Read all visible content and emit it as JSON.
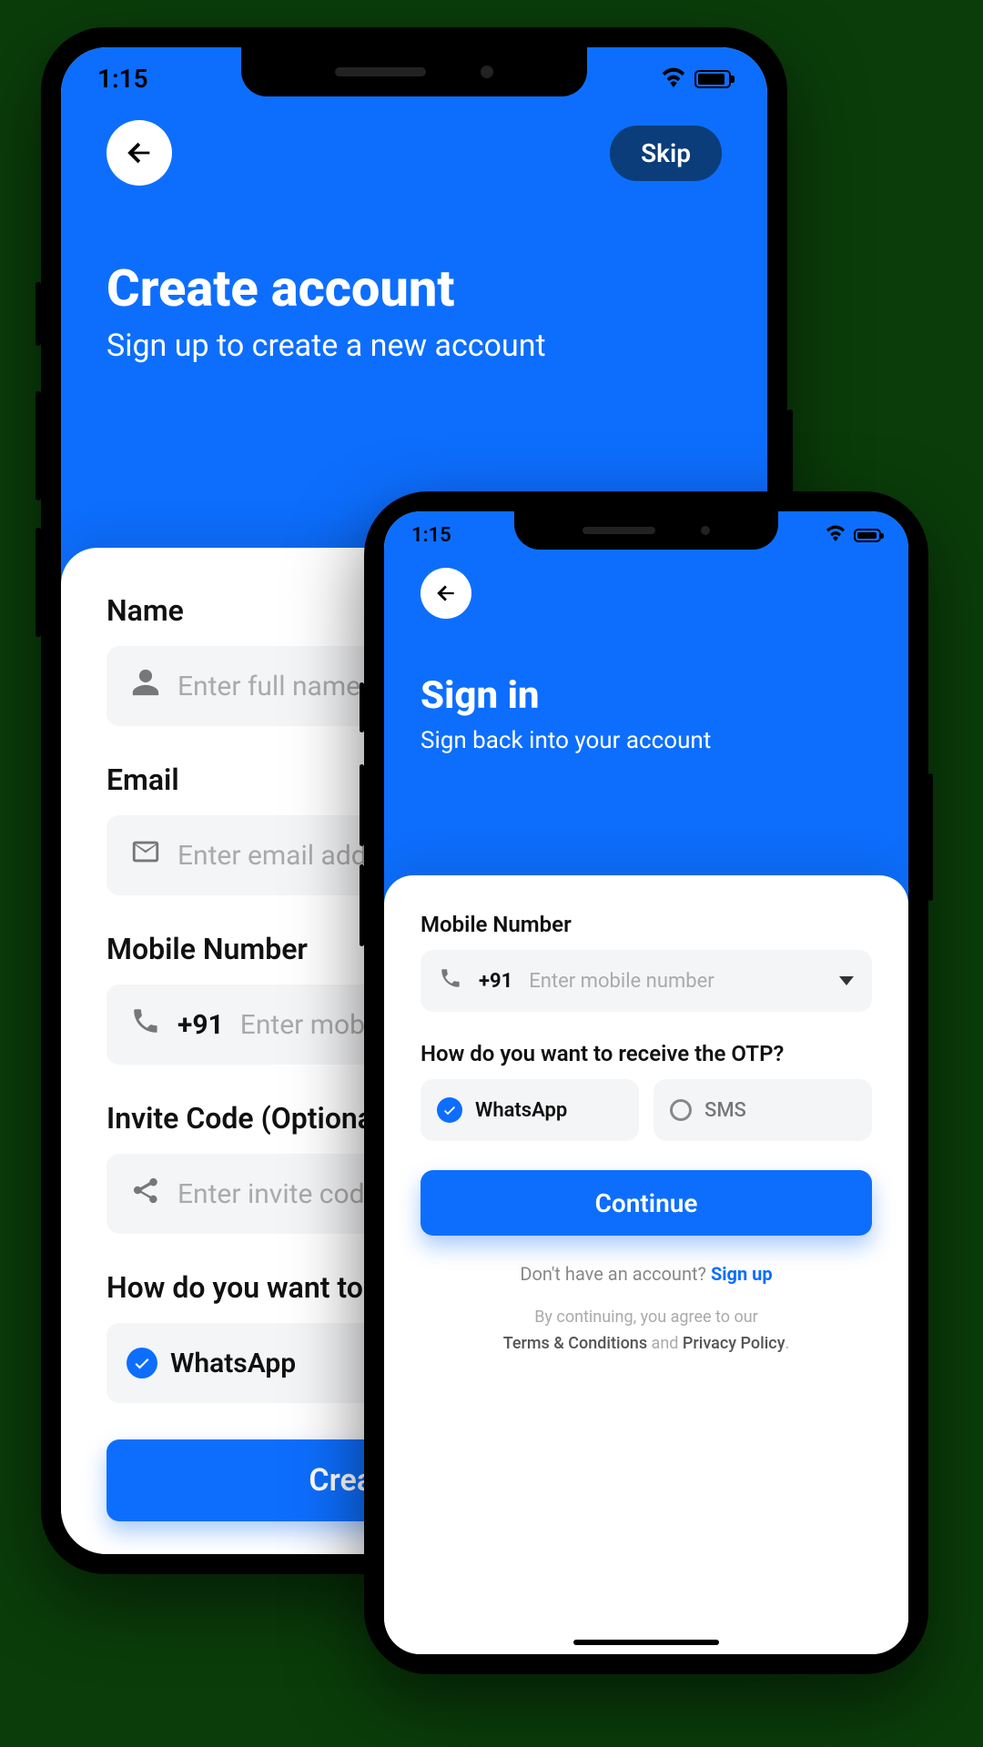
{
  "status_time": "1:15",
  "large": {
    "title": "Create account",
    "subtitle": "Sign up to create a new account",
    "skip_label": "Skip",
    "fields": {
      "name_label": "Name",
      "name_placeholder": "Enter full name",
      "email_label": "Email",
      "email_placeholder": "Enter email address",
      "mobile_label": "Mobile Number",
      "mobile_prefix": "+91",
      "mobile_placeholder": "Enter mobile number",
      "invite_label": "Invite Code (Optional)",
      "invite_placeholder": "Enter invite code"
    },
    "otp_question": "How do you want to receive the OTP?",
    "otp_whatsapp": "WhatsApp",
    "primary_button": "Create account"
  },
  "small": {
    "title": "Sign in",
    "subtitle": "Sign back into your account",
    "mobile_label": "Mobile Number",
    "mobile_prefix": "+91",
    "mobile_placeholder": "Enter mobile number",
    "otp_question": "How do you want to receive the OTP?",
    "otp_whatsapp": "WhatsApp",
    "otp_sms": "SMS",
    "primary_button": "Continue",
    "footer_prompt": "Don't have an account? ",
    "footer_link": "Sign up",
    "legal_prefix": "By continuing, you agree to our",
    "legal_terms": "Terms & Conditions",
    "legal_and": " and ",
    "legal_privacy": "Privacy Policy"
  }
}
